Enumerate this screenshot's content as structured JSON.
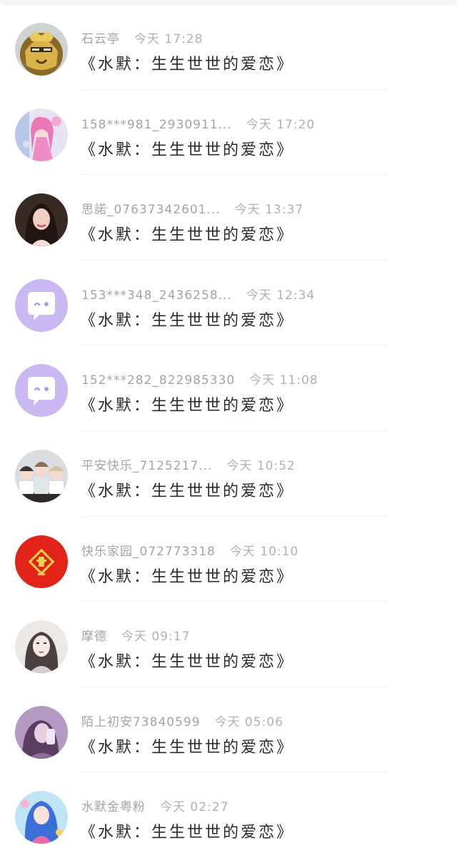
{
  "messages": [
    {
      "name": "石云亭",
      "time": "今天 17:28",
      "text": "《水默：生生世世的爱恋》",
      "avatar": "golden-mask-avatar"
    },
    {
      "name": "158***981_2930911...",
      "time": "今天 17:20",
      "text": "《水默：生生世世的爱恋》",
      "avatar": "pink-anime-girl-avatar"
    },
    {
      "name": "思諾_07637342601...",
      "time": "今天 13:37",
      "text": "《水默：生生世世的爱恋》",
      "avatar": "photo-girl-avatar"
    },
    {
      "name": "153***348_2436258...",
      "time": "今天 12:34",
      "text": "《水默：生生世世的爱恋》",
      "avatar": "default-chat-bubble-avatar"
    },
    {
      "name": "152***282_822985330",
      "time": "今天 11:08",
      "text": "《水默：生生世世的爱恋》",
      "avatar": "default-chat-bubble-avatar"
    },
    {
      "name": "平安快乐_7125217...",
      "time": "今天 10:52",
      "text": "《水默：生生世世的爱恋》",
      "avatar": "anime-group-avatar"
    },
    {
      "name": "快乐家园_072773318",
      "time": "今天 10:10",
      "text": "《水默：生生世世的爱恋》",
      "avatar": "red-fu-avatar"
    },
    {
      "name": "摩德",
      "time": "今天 09:17",
      "text": "《水默：生生世世的爱恋》",
      "avatar": "sketch-girl-avatar"
    },
    {
      "name": "陌上初安73840599",
      "time": "今天 05:06",
      "text": "《水默：生生世世的爱恋》",
      "avatar": "purple-girl-avatar"
    },
    {
      "name": "水默金粤粉",
      "time": "今天 02:27",
      "text": "《水默：生生世世的爱恋》",
      "avatar": "blue-anime-girl-avatar"
    }
  ],
  "colors": {
    "default_avatar_bg": "#c9b8f2",
    "fu_red": "#e2231a"
  }
}
